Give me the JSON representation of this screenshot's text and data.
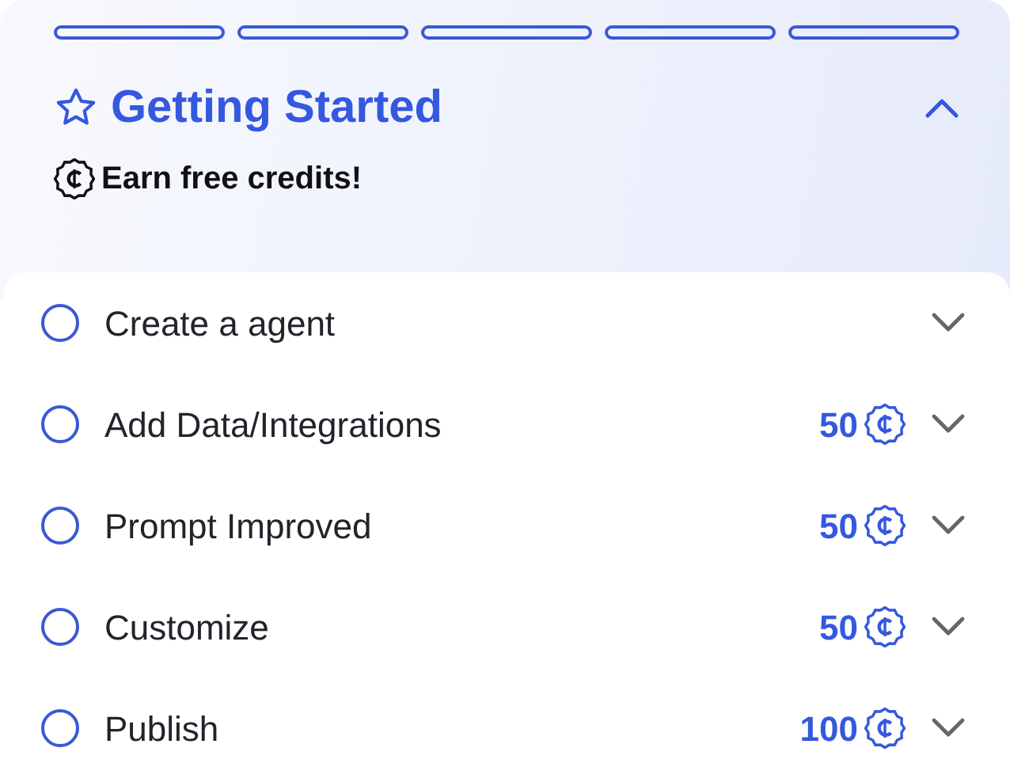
{
  "progress_steps": [
    {
      "done": false
    },
    {
      "done": false
    },
    {
      "done": false
    },
    {
      "done": false
    },
    {
      "done": false
    }
  ],
  "header": {
    "title": "Getting Started",
    "subtitle": "Earn free credits!",
    "expanded": true
  },
  "tasks": [
    {
      "label": "Create a agent",
      "checked": false,
      "expanded": false
    },
    {
      "label": "Add Data/Integrations",
      "credits": "50",
      "checked": false,
      "expanded": false
    },
    {
      "label": "Prompt Improved",
      "credits": "50",
      "checked": false,
      "expanded": false
    },
    {
      "label": "Customize",
      "credits": "50",
      "checked": false,
      "expanded": false
    },
    {
      "label": "Publish",
      "credits": "100",
      "checked": false,
      "expanded": false
    }
  ]
}
